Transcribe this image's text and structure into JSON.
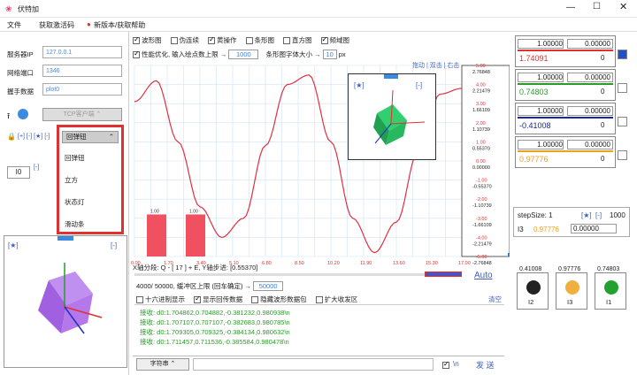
{
  "app": {
    "title": "伏特加"
  },
  "menu": [
    "文件",
    "获取激活码",
    "新版本/获取帮助"
  ],
  "colors": {
    "accent": "#3a7fd5",
    "plot": "#e03040",
    "grid": "#cfe3f7"
  },
  "conn": {
    "ip_label": "服务器IP",
    "ip": "127.0.0.1",
    "port_label": "网络端口",
    "port": "1346",
    "data_label": "握手数据",
    "data": "plot0",
    "mode": "TCP客户端"
  },
  "drop": {
    "selected": "回弹钮",
    "options": [
      "回弹钮",
      "立方",
      "状态灯",
      "滑动条"
    ]
  },
  "small": {
    "sig_tags": "[+] [-] [★] [-]",
    "value": "I0",
    "star": "[★]",
    "minus": "[-]"
  },
  "checks": {
    "r1": [
      {
        "t": "波形图",
        "on": true
      },
      {
        "t": "伪连续",
        "on": false
      },
      {
        "t": "黄操作",
        "on": true
      },
      {
        "t": "条形图",
        "on": false
      },
      {
        "t": "直方图",
        "on": false
      },
      {
        "t": "频域图",
        "on": true
      }
    ],
    "perf": "性能优化, 输入绘点数上限 →",
    "perf_val": "1000",
    "font": "条形图字体大小 →",
    "font_val": "10",
    "font_unit": "px"
  },
  "links": "拖动 | 双击 | 右击",
  "chart_data": {
    "type": "line",
    "series": [
      {
        "values": [
          3.1,
          4.2,
          1.0,
          -2.4,
          -4.0,
          -3.0,
          0.8,
          4.0,
          4.5,
          1.0,
          -3.0,
          -4.8,
          -3.2,
          0.5,
          3.5,
          3.8
        ]
      }
    ],
    "bars": [
      {
        "label": "1.00",
        "value": 1.0
      },
      {
        "label": "1.00",
        "value": 1.0
      }
    ],
    "ylim": [
      -5,
      5
    ],
    "xticks": [
      "0.00",
      "1.70",
      "3.40",
      "5.10",
      "6.80",
      "8.50",
      "10.20",
      "11.90",
      "13.60",
      "15.30",
      "17.00"
    ],
    "yticks": [
      "5.00",
      "4.00",
      "3.00",
      "2.00",
      "1.00",
      "0.00",
      "-1.00",
      "-2.00",
      "-3.00",
      "-4.00",
      "-5.00"
    ],
    "rticks": [
      "2.76848",
      "2.21479",
      "1.66109",
      "1.10739",
      "0.55370",
      "0.00000",
      "-0.55370",
      "-1.10739",
      "-1.66109",
      "-2.21479",
      "-2.76848"
    ]
  },
  "xinfo": "X轴分段: Q - [ 17 ] + E,  Y轴步进: [0.55370]",
  "status": {
    "count": "4000/ 50000, 缓冲区上限 (回车确定) →",
    "count_val": "50000",
    "auto": "Auto"
  },
  "opts": {
    "o1": "十六进制显示",
    "o2": "显示回传数据",
    "o3": "隐藏波形数据包",
    "o4": "扩大收发区",
    "clear": "清空"
  },
  "rx": [
    "接收: d0:1.704862,0.704882,-0.381232,0.980938\\n",
    "接收: d0:1.707107,0.707107,-0.382683,0.980785\\n",
    "接收: d0:1.709305,0.709325,-0.384134,0.980632\\n",
    "接收: d0:1.711457,0.711536,-0.385584,0.980478\\n"
  ],
  "send": {
    "type": "字符串",
    "nl": "\\n",
    "btn": "发 送"
  },
  "channels": [
    {
      "a": "1.00000",
      "b": "0.00000",
      "v": "1.74091",
      "c": "#e03030",
      "r": "0"
    },
    {
      "a": "1.00000",
      "b": "0.00000",
      "v": "0.74803",
      "c": "#2a9a2a",
      "r": "0"
    },
    {
      "a": "1.00000",
      "b": "0.00000",
      "v": "-0.41008",
      "c": "#1a2a8a",
      "r": "0"
    },
    {
      "a": "1.00000",
      "b": "0.00000",
      "v": "0.97776",
      "c": "#f0a020",
      "r": "0"
    }
  ],
  "step": {
    "label": "stepSize: 1",
    "star": "[★]",
    "minus": "[-]",
    "max": "1000",
    "idx": "I3",
    "val": "0.97776",
    "input": "0.00000"
  },
  "lights": [
    {
      "tag": "I2",
      "v": "0.41008",
      "c": "#222"
    },
    {
      "tag": "I3",
      "v": "0.97776",
      "c": "#f0b040"
    },
    {
      "tag": "I1",
      "v": "0.74803",
      "c": "#22a030"
    }
  ]
}
